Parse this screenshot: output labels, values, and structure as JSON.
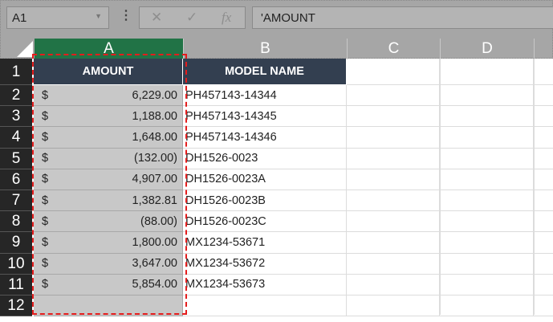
{
  "namebox": {
    "value": "A1"
  },
  "formula_bar": {
    "value": "'AMOUNT",
    "cancel": "✕",
    "enter": "✓",
    "fx": "fx"
  },
  "columns": [
    "A",
    "B",
    "C",
    "D"
  ],
  "headers": {
    "amount": "AMOUNT",
    "model": "MODEL NAME"
  },
  "rows": [
    {
      "n": "1"
    },
    {
      "n": "2",
      "cur": "$",
      "amt": "6,229.00",
      "model": "PH457143-14344"
    },
    {
      "n": "3",
      "cur": "$",
      "amt": "1,188.00",
      "model": "PH457143-14345"
    },
    {
      "n": "4",
      "cur": "$",
      "amt": "1,648.00",
      "model": "PH457143-14346"
    },
    {
      "n": "5",
      "cur": "$",
      "amt": "(132.00)",
      "model": "DH1526-0023"
    },
    {
      "n": "6",
      "cur": "$",
      "amt": "4,907.00",
      "model": "DH1526-0023A"
    },
    {
      "n": "7",
      "cur": "$",
      "amt": "1,382.81",
      "model": "DH1526-0023B"
    },
    {
      "n": "8",
      "cur": "$",
      "amt": "(88.00)",
      "model": "DH1526-0023C"
    },
    {
      "n": "9",
      "cur": "$",
      "amt": "1,800.00",
      "model": "MX1234-53671"
    },
    {
      "n": "10",
      "cur": "$",
      "amt": "3,647.00",
      "model": "MX1234-53672"
    },
    {
      "n": "11",
      "cur": "$",
      "amt": "5,854.00",
      "model": "MX1234-53673"
    },
    {
      "n": "12"
    }
  ]
}
